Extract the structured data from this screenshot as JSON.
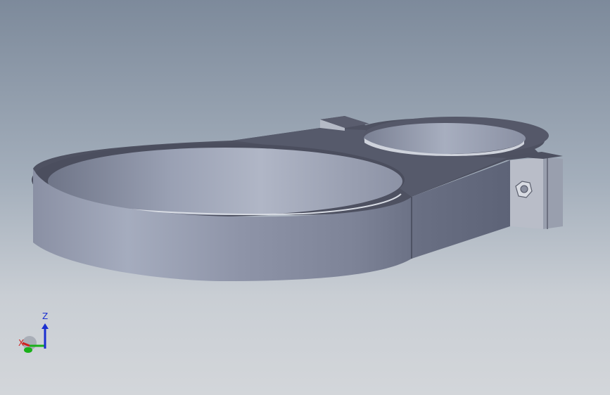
{
  "viewport": {
    "background_top": "#7d8a9b",
    "background_bottom": "#d3d6da"
  },
  "model": {
    "icon": "clamp-bracket-3d-model",
    "part_color": "#8d93a6"
  },
  "triad": {
    "z_label": "Z",
    "x_label": "X",
    "z_color": "#1a2fd0",
    "x_color": "#d02020",
    "y_color": "#19b019"
  }
}
